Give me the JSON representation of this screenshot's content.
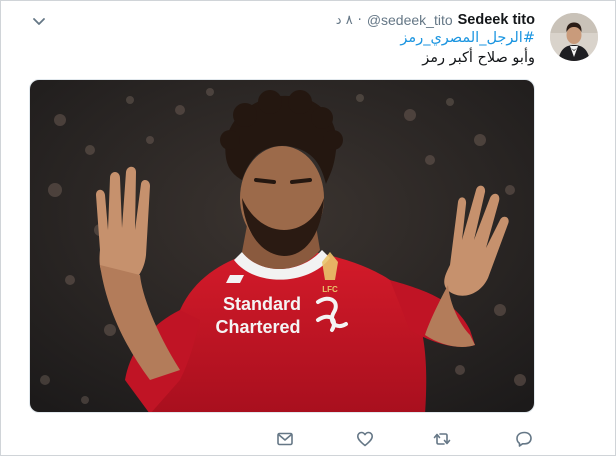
{
  "tweet": {
    "author_name": "Sedeek tito",
    "author_handle": "@sedeek_tito",
    "separator": "·",
    "timestamp": "٨ د",
    "hashtag": "#الرجل_المصري_رمز",
    "text": "وأبو صلاح أكبر رمز"
  },
  "media": {
    "jersey_sponsor_line1": "Standard",
    "jersey_sponsor_line2": "Chartered",
    "crest_label": "LFC"
  },
  "icons": {
    "caret": "chevron-down-icon",
    "reply": "reply-icon",
    "retweet": "retweet-icon",
    "like": "heart-icon",
    "dm": "envelope-icon"
  },
  "colors": {
    "link": "#1b95e0",
    "muted": "#657786",
    "icon": "#657786",
    "jersey_red": "#c8102e"
  }
}
